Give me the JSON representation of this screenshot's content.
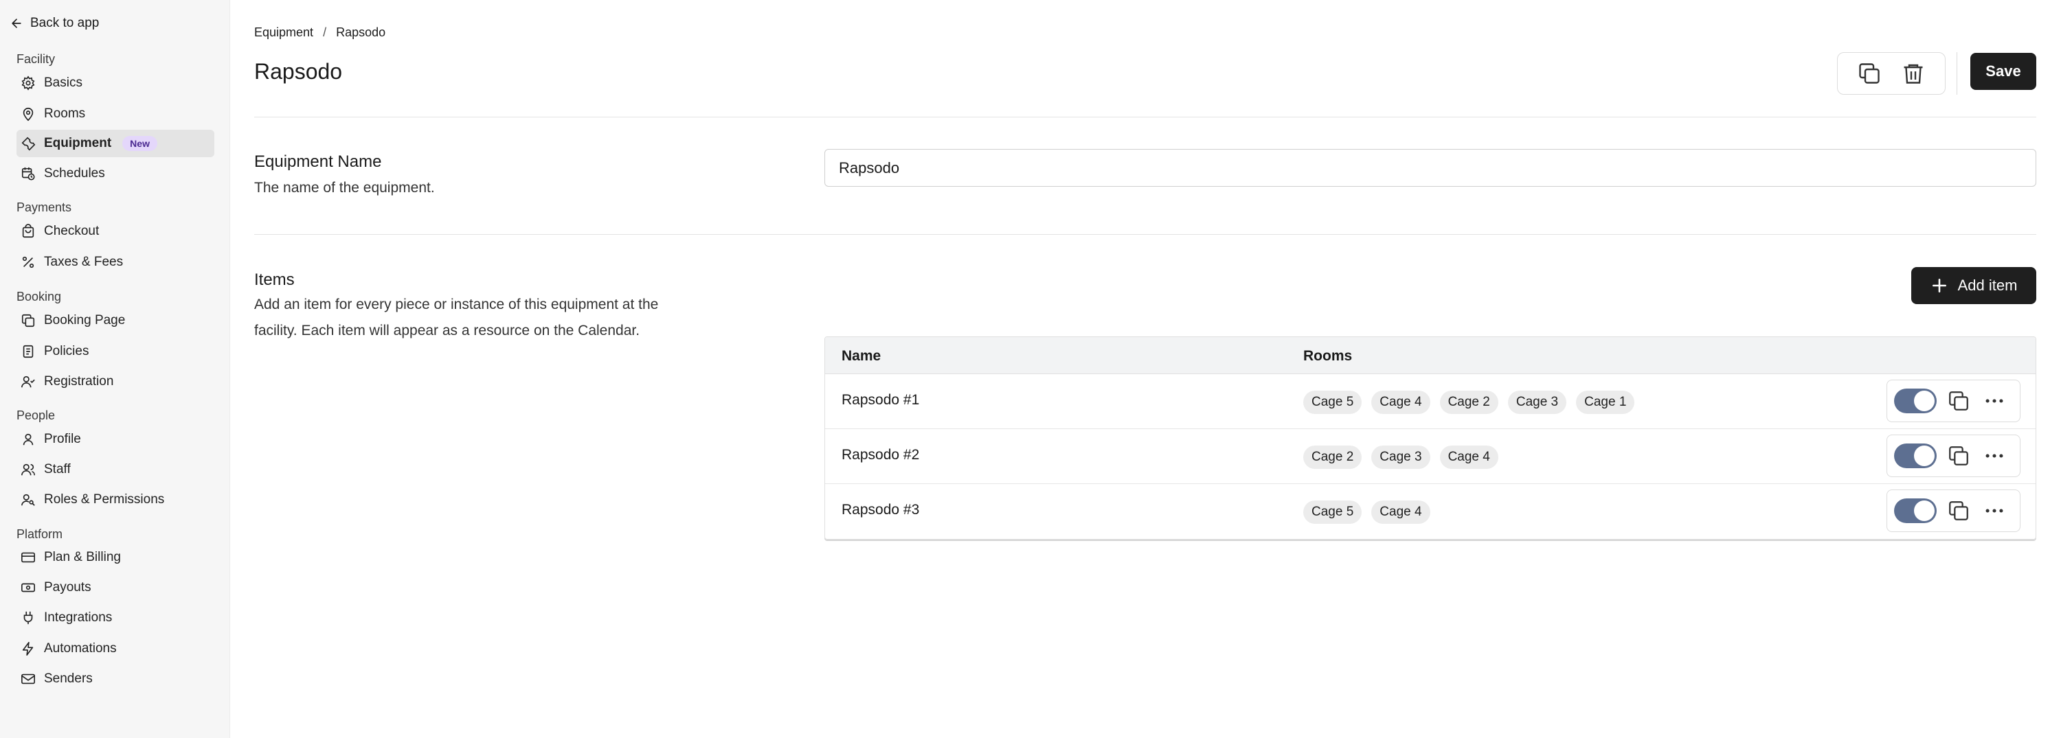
{
  "sidebar": {
    "back_label": "Back to app",
    "sections": [
      {
        "title": "Facility",
        "items": [
          {
            "label": "Basics",
            "icon": "gear-icon"
          },
          {
            "label": "Rooms",
            "icon": "map-pin-icon"
          },
          {
            "label": "Equipment",
            "icon": "wrench-icon",
            "badge": "New",
            "active": true
          },
          {
            "label": "Schedules",
            "icon": "calendar-clock-icon"
          }
        ]
      },
      {
        "title": "Payments",
        "items": [
          {
            "label": "Checkout",
            "icon": "shopping-bag-icon"
          },
          {
            "label": "Taxes & Fees",
            "icon": "percent-icon"
          }
        ]
      },
      {
        "title": "Booking",
        "items": [
          {
            "label": "Booking Page",
            "icon": "layers-icon"
          },
          {
            "label": "Policies",
            "icon": "document-icon"
          },
          {
            "label": "Registration",
            "icon": "user-check-icon"
          }
        ]
      },
      {
        "title": "People",
        "items": [
          {
            "label": "Profile",
            "icon": "user-icon"
          },
          {
            "label": "Staff",
            "icon": "users-icon"
          },
          {
            "label": "Roles & Permissions",
            "icon": "user-key-icon"
          }
        ]
      },
      {
        "title": "Platform",
        "items": [
          {
            "label": "Plan & Billing",
            "icon": "credit-card-icon"
          },
          {
            "label": "Payouts",
            "icon": "banknote-icon"
          },
          {
            "label": "Integrations",
            "icon": "plug-icon"
          },
          {
            "label": "Automations",
            "icon": "lightning-icon"
          },
          {
            "label": "Senders",
            "icon": "mail-icon"
          }
        ]
      }
    ]
  },
  "breadcrumb": {
    "parent": "Equipment",
    "separator": "/",
    "current": "Rapsodo"
  },
  "page_title": "Rapsodo",
  "toolbar": {
    "save_label": "Save"
  },
  "equipment_name": {
    "title": "Equipment Name",
    "description": "The name of the equipment.",
    "value": "Rapsodo"
  },
  "items_section": {
    "title": "Items",
    "description": "Add an item for every piece or instance of this equipment at the facility. Each item will appear as a resource on the Calendar.",
    "add_label": "Add item",
    "columns": [
      "Name",
      "Rooms"
    ],
    "rows": [
      {
        "name": "Rapsodo #1",
        "rooms": [
          "Cage 5",
          "Cage 4",
          "Cage 2",
          "Cage 3",
          "Cage 1"
        ],
        "enabled": true
      },
      {
        "name": "Rapsodo #2",
        "rooms": [
          "Cage 2",
          "Cage 3",
          "Cage 4"
        ],
        "enabled": true
      },
      {
        "name": "Rapsodo #3",
        "rooms": [
          "Cage 5",
          "Cage 4"
        ],
        "enabled": true
      }
    ]
  },
  "colors": {
    "primary_button": "#1f1f1f",
    "toggle_on": "#5d6f91",
    "badge_bg": "#e4d7fb"
  }
}
